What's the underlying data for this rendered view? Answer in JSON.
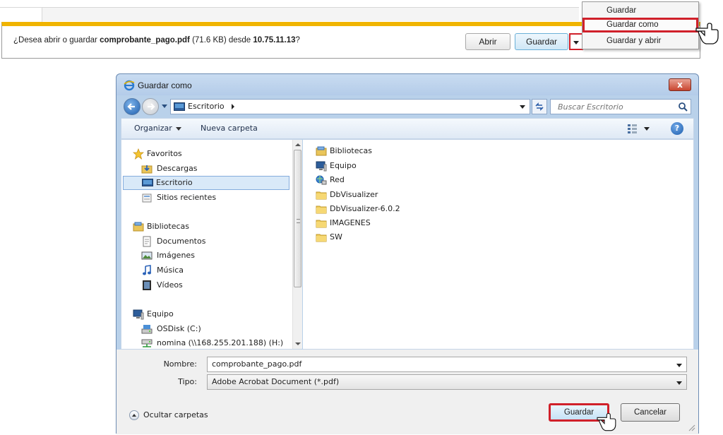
{
  "download_bar": {
    "msg_prefix": "¿Desea abrir o guardar ",
    "file_name": "comprobante_pago.pdf",
    "file_size": " (71.6 KB) desde ",
    "host": "10.75.11.13",
    "msg_suffix": "?",
    "open_label": "Abrir",
    "save_label": "Guardar",
    "accent_color": "#f0b400"
  },
  "save_menu": {
    "items": [
      "Guardar",
      "Guardar como",
      "Guardar y abrir"
    ],
    "highlighted": "Guardar como",
    "highlight_color": "#d0202a"
  },
  "dialog": {
    "title": "Guardar como",
    "close_label": "x",
    "address": {
      "path": "Escritorio",
      "search_placeholder": "Buscar Escritorio"
    },
    "toolbar": {
      "organize": "Organizar",
      "new_folder": "Nueva carpeta",
      "help": "?"
    },
    "nav_tree": [
      {
        "label": "Favoritos",
        "level": 0,
        "icon": "star-icon"
      },
      {
        "label": "Descargas",
        "level": 1,
        "icon": "downloads-folder-icon"
      },
      {
        "label": "Escritorio",
        "level": 1,
        "icon": "desktop-icon",
        "selected": true
      },
      {
        "label": "Sitios recientes",
        "level": 1,
        "icon": "recent-places-icon"
      },
      {
        "label": "Bibliotecas",
        "level": 0,
        "icon": "libraries-icon"
      },
      {
        "label": "Documentos",
        "level": 1,
        "icon": "documents-icon"
      },
      {
        "label": "Imágenes",
        "level": 1,
        "icon": "pictures-icon"
      },
      {
        "label": "Música",
        "level": 1,
        "icon": "music-icon"
      },
      {
        "label": "Vídeos",
        "level": 1,
        "icon": "videos-icon"
      },
      {
        "label": "Equipo",
        "level": 0,
        "icon": "computer-icon"
      },
      {
        "label": "OSDisk (C:)",
        "level": 1,
        "icon": "drive-icon"
      },
      {
        "label": "nomina (\\\\168.255.201.188) (H:)",
        "level": 1,
        "icon": "network-drive-icon"
      }
    ],
    "files": [
      {
        "label": "Bibliotecas",
        "icon": "libraries-icon"
      },
      {
        "label": "Equipo",
        "icon": "computer-icon"
      },
      {
        "label": "Red",
        "icon": "network-icon"
      },
      {
        "label": "DbVisualizer",
        "icon": "folder-icon"
      },
      {
        "label": "DbVisualizer-6.0.2",
        "icon": "folder-icon"
      },
      {
        "label": "IMAGENES",
        "icon": "folder-icon"
      },
      {
        "label": "SW",
        "icon": "folder-icon"
      }
    ],
    "filename_label": "Nombre:",
    "filename_value": "comprobante_pago.pdf",
    "type_label": "Tipo:",
    "type_value": "Adobe Acrobat Document (*.pdf)",
    "hide_folders": "Ocultar carpetas",
    "save_button": "Guardar",
    "cancel_button": "Cancelar"
  }
}
